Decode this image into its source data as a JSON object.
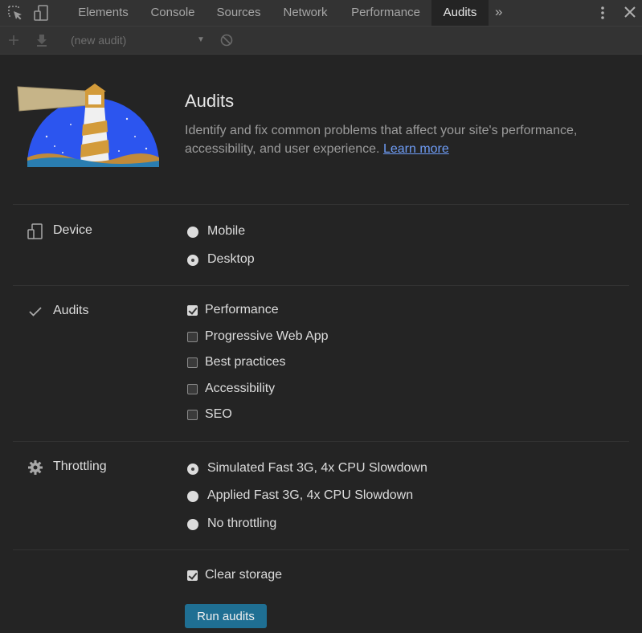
{
  "tabs": [
    "Elements",
    "Console",
    "Sources",
    "Network",
    "Performance",
    "Audits"
  ],
  "active_tab": "Audits",
  "toolbar": {
    "audit_select_value": "(new audit)"
  },
  "header": {
    "title": "Audits",
    "description": "Identify and fix common problems that affect your site's performance, accessibility, and user experience.",
    "learn_more": "Learn more"
  },
  "device": {
    "label": "Device",
    "options": [
      {
        "label": "Mobile",
        "checked": false
      },
      {
        "label": "Desktop",
        "checked": true
      }
    ]
  },
  "audits": {
    "label": "Audits",
    "options": [
      {
        "label": "Performance",
        "checked": true
      },
      {
        "label": "Progressive Web App",
        "checked": false
      },
      {
        "label": "Best practices",
        "checked": false
      },
      {
        "label": "Accessibility",
        "checked": false
      },
      {
        "label": "SEO",
        "checked": false
      }
    ]
  },
  "throttling": {
    "label": "Throttling",
    "options": [
      {
        "label": "Simulated Fast 3G, 4x CPU Slowdown",
        "checked": true
      },
      {
        "label": "Applied Fast 3G, 4x CPU Slowdown",
        "checked": false
      },
      {
        "label": "No throttling",
        "checked": false
      }
    ]
  },
  "clear_storage": {
    "label": "Clear storage",
    "checked": true
  },
  "run_button": "Run audits",
  "colors": {
    "accent": "#1f6f93",
    "link": "#6e9cf5",
    "background": "#242424",
    "toolbar": "#333333"
  }
}
